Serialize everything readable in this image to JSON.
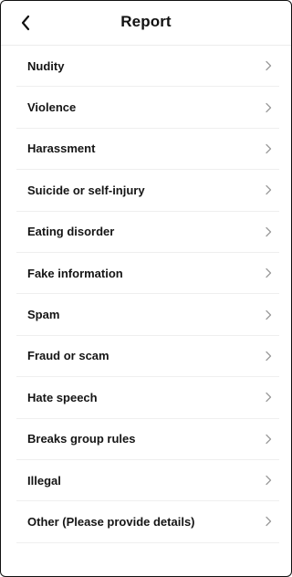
{
  "header": {
    "title": "Report",
    "back_icon": "chevron-left-icon"
  },
  "reasons": [
    {
      "label": "Nudity"
    },
    {
      "label": "Violence"
    },
    {
      "label": "Harassment"
    },
    {
      "label": "Suicide or self-injury"
    },
    {
      "label": "Eating disorder"
    },
    {
      "label": "Fake information"
    },
    {
      "label": "Spam"
    },
    {
      "label": "Fraud or scam"
    },
    {
      "label": "Hate speech"
    },
    {
      "label": "Breaks group rules"
    },
    {
      "label": "Illegal"
    },
    {
      "label": "Other (Please provide details)"
    }
  ],
  "row_icon": "chevron-right-icon",
  "colors": {
    "text": "#151515",
    "chevron": "#9a9a9a",
    "divider": "#efefef"
  }
}
